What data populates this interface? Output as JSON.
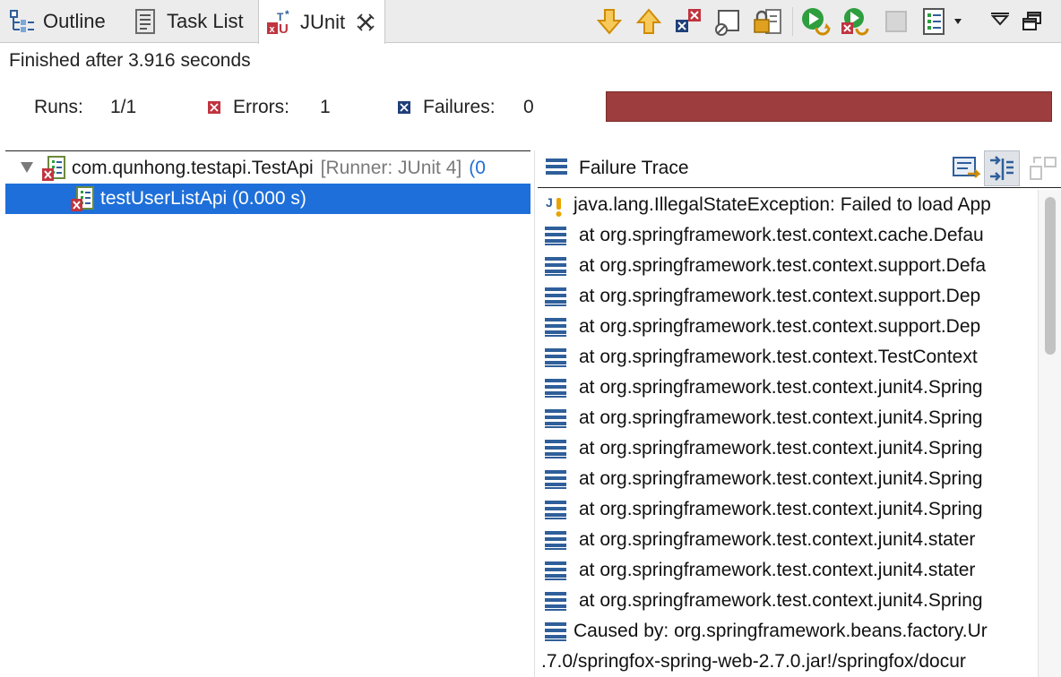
{
  "tabs": [
    {
      "label": "Outline",
      "icon": "outline-icon"
    },
    {
      "label": "Task List",
      "icon": "task-list-icon"
    },
    {
      "label": "JUnit",
      "icon": "junit-icon",
      "active": true
    }
  ],
  "toolbar": {
    "buttons": [
      "next-failure-icon",
      "previous-failure-icon",
      "show-failures-only-icon",
      "scroll-lock-icon",
      "lock-icon",
      "rerun-test-icon",
      "rerun-failed-first-icon",
      "stop-icon",
      "test-run-history-icon",
      "view-menu-icon",
      "maximize-icon"
    ]
  },
  "status": {
    "text": "Finished after 3.916 seconds"
  },
  "counters": {
    "runs_label": "Runs:",
    "runs_value": "1/1",
    "errors_label": "Errors:",
    "errors_value": "1",
    "failures_label": "Failures:",
    "failures_value": "0"
  },
  "progress": {
    "fraction": 1.0,
    "color": "#9e3d3d"
  },
  "tree": {
    "suite_name": "com.qunhong.testapi.TestApi",
    "suite_runner": "[Runner: JUnit 4]",
    "suite_time": "(0",
    "test_name": "testUserListApi (0.000 s)"
  },
  "trace": {
    "title": "Failure Trace",
    "lines": [
      "java.lang.IllegalStateException: Failed to load App",
      "at org.springframework.test.context.cache.Defau",
      "at org.springframework.test.context.support.Defa",
      "at org.springframework.test.context.support.Dep",
      "at org.springframework.test.context.support.Dep",
      "at org.springframework.test.context.TestContext",
      "at org.springframework.test.context.junit4.Spring",
      "at org.springframework.test.context.junit4.Spring",
      "at org.springframework.test.context.junit4.Spring",
      "at org.springframework.test.context.junit4.Spring",
      "at org.springframework.test.context.junit4.Spring",
      "at org.springframework.test.context.junit4.stater",
      "at org.springframework.test.context.junit4.stater",
      "at org.springframework.test.context.junit4.Spring",
      "Caused by: org.springframework.beans.factory.Ur",
      ".7.0/springfox-spring-web-2.7.0.jar!/springfox/docur"
    ]
  },
  "colors": {
    "accent": "#1e6fd9",
    "error": "#c0343f",
    "failure": "#1f3f78",
    "run_green": "#2e9e3e",
    "warn": "#e8a400"
  }
}
